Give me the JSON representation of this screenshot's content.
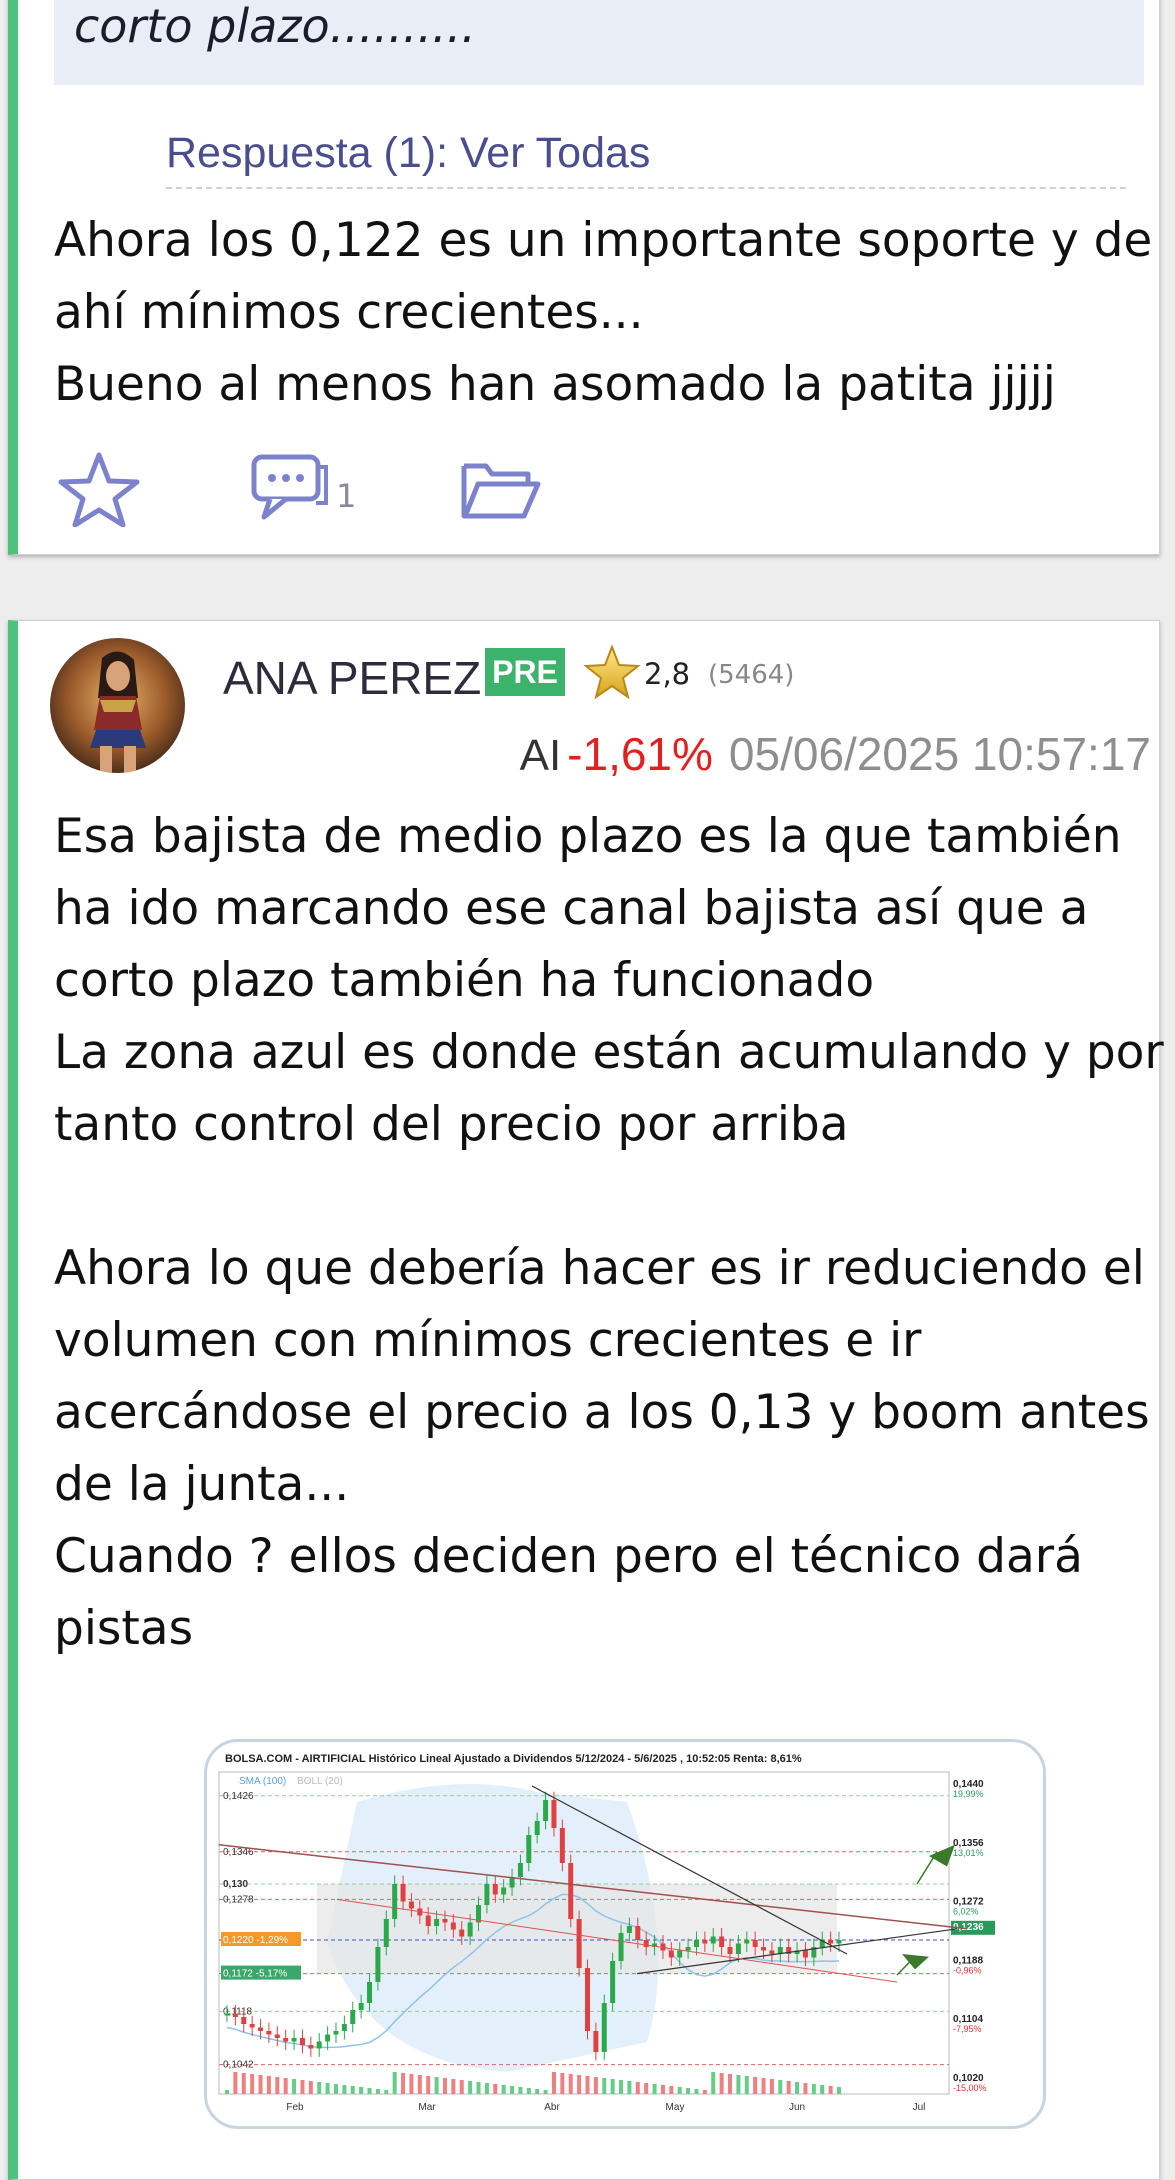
{
  "previous_post": {
    "quote_text": "corto plazo..........",
    "reply_link": "Respuesta (1): Ver Todas",
    "reply_body": "Ahora los 0,122 es un importante soporte y de ahí mínimos crecientes...\nBueno al menos han asomado la patita jjjjj",
    "actions": {
      "favorite_icon": "star-outline-icon",
      "comments_icon": "speech-bubbles-icon",
      "comment_count": "1",
      "folder_icon": "folder-open-icon"
    }
  },
  "post": {
    "author": "ANA PEREZ",
    "badge": "PRE",
    "rating": "2,8",
    "rating_count": "(5464)",
    "ticker": "AI",
    "change": "-1,61%",
    "timestamp": "05/06/2025 10:57:17",
    "body": "Esa bajista de medio plazo es la que también ha ido marcando ese canal bajista así que a corto plazo también ha funcionado\nLa zona azul es donde están acumulando y por tanto control del precio por arriba\n\nAhora lo que debería hacer es ir reduciendo el volumen con mínimos crecientes e ir acercándose el precio a los 0,13 y boom antes de la junta...\nCuando ? ellos deciden pero el técnico dará pistas",
    "colors": {
      "accent_bar": "#4cc27a",
      "negative": "#e41f1f",
      "link": "#4a4e8e"
    }
  },
  "chart_data": {
    "type": "candlestick",
    "title": "BOLSA.COM - AIRTIFICIAL Histórico Lineal Ajustado a Dividendos 5/12/2024 - 5/6/2025 , 10:52:05 Renta: 8,61%",
    "legend": [
      "SMA (100)",
      "BOLL (20)"
    ],
    "x_ticks": [
      "Feb",
      "Mar",
      "Abr",
      "May",
      "Jun",
      "Jul"
    ],
    "left_levels": [
      "0,1426",
      "0,1346",
      "0,130",
      "0,1278",
      "0,1220 -1,29%",
      "0,1172 -5,17%",
      "0,1118",
      "0,1042"
    ],
    "right_levels": [
      {
        "price": "0,1440",
        "pct": "19,99%"
      },
      {
        "price": "0,1356",
        "pct": "13,01%"
      },
      {
        "price": "0,1272",
        "pct": "6,02%"
      },
      {
        "price": "0,1236",
        "pct": ""
      },
      {
        "price": "0,1188",
        "pct": "-0,96%"
      },
      {
        "price": "0,1104",
        "pct": "-7,95%"
      },
      {
        "price": "0,1020",
        "pct": "-15,00%"
      }
    ],
    "ylim": [
      0.1,
      0.146
    ],
    "prices": [
      0.1115,
      0.111,
      0.11,
      0.1095,
      0.109,
      0.1085,
      0.108,
      0.1075,
      0.108,
      0.107,
      0.1065,
      0.1075,
      0.1085,
      0.109,
      0.11,
      0.112,
      0.113,
      0.116,
      0.121,
      0.125,
      0.13,
      0.1275,
      0.1265,
      0.1255,
      0.124,
      0.125,
      0.1245,
      0.1235,
      0.1225,
      0.1245,
      0.127,
      0.13,
      0.1285,
      0.1295,
      0.131,
      0.133,
      0.137,
      0.139,
      0.142,
      0.138,
      0.133,
      0.125,
      0.118,
      0.109,
      0.106,
      0.113,
      0.119,
      0.123,
      0.124,
      0.122,
      0.121,
      0.1215,
      0.1205,
      0.1195,
      0.1205,
      0.121,
      0.122,
      0.1215,
      0.1225,
      0.121,
      0.12,
      0.1215,
      0.122,
      0.121,
      0.1205,
      0.12,
      0.121,
      0.12,
      0.1205,
      0.1195,
      0.121,
      0.122,
      0.1215,
      0.122
    ]
  }
}
